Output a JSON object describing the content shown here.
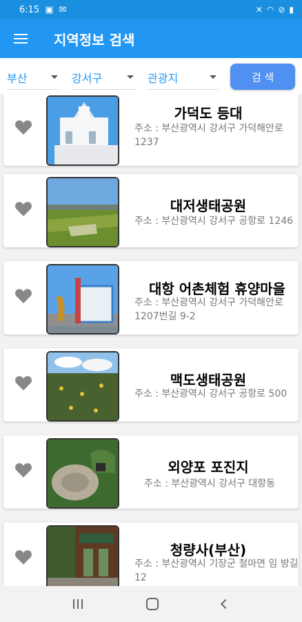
{
  "status": {
    "time": "6:15",
    "left_icons": [
      "image-icon",
      "mail-icon"
    ],
    "right_icons": [
      "mute-icon",
      "wifi-icon",
      "dnd-icon",
      "battery-icon"
    ]
  },
  "appbar": {
    "title": "지역정보 검색",
    "menu_icon": "hamburger-icon"
  },
  "filters": {
    "region": "부산",
    "district": "강서구",
    "category": "관광지",
    "search_label": "검 색"
  },
  "colors": {
    "primary": "#2196f3",
    "status": "#1a8fe0",
    "button": "#4f90f0"
  },
  "items": [
    {
      "name": "가덕도 등대",
      "address": "주소 : 부산광역시 강서구 가덕해안로 1237",
      "photo": "lighthouse"
    },
    {
      "name": "대저생태공원",
      "address": "주소 : 부산광역시 강서구 공항로 1246",
      "photo": "park"
    },
    {
      "name": "대항 어촌체험 휴양마을",
      "address": "주소 : 부산광역시 강서구 가덕해안로 1207번길 9-2",
      "photo": "village"
    },
    {
      "name": "맥도생태공원",
      "address": "주소 : 부산광역시 강서구 공항로 500",
      "photo": "lotus"
    },
    {
      "name": "외양포 포진지",
      "address": "주소 : 부산광역시 강서구 대항동",
      "photo": "fort"
    },
    {
      "name": "청량사(부산)",
      "address": "주소 : 부산광역시 기장군 철마면 임 방길 12",
      "photo": "temple"
    }
  ],
  "navbar": {
    "icons": [
      "recent-apps-icon",
      "home-icon",
      "back-icon"
    ]
  }
}
